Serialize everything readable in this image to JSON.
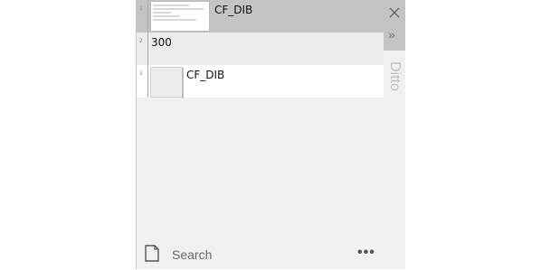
{
  "clips": [
    {
      "index": "1",
      "text": "CF_DIB"
    },
    {
      "index": "2",
      "text": "300"
    },
    {
      "index": "3",
      "text": "CF_DIB"
    }
  ],
  "side": {
    "close_icon": "close-icon",
    "expand_icon": "double-chevron-right-icon",
    "expand_glyph": "»",
    "title": "Ditto"
  },
  "search": {
    "placeholder": "Search"
  },
  "more_label": "•••",
  "colors": {
    "selected_row": "#c4c4c4",
    "panel_bg": "#f0f0f0",
    "row_white": "#ffffff"
  }
}
